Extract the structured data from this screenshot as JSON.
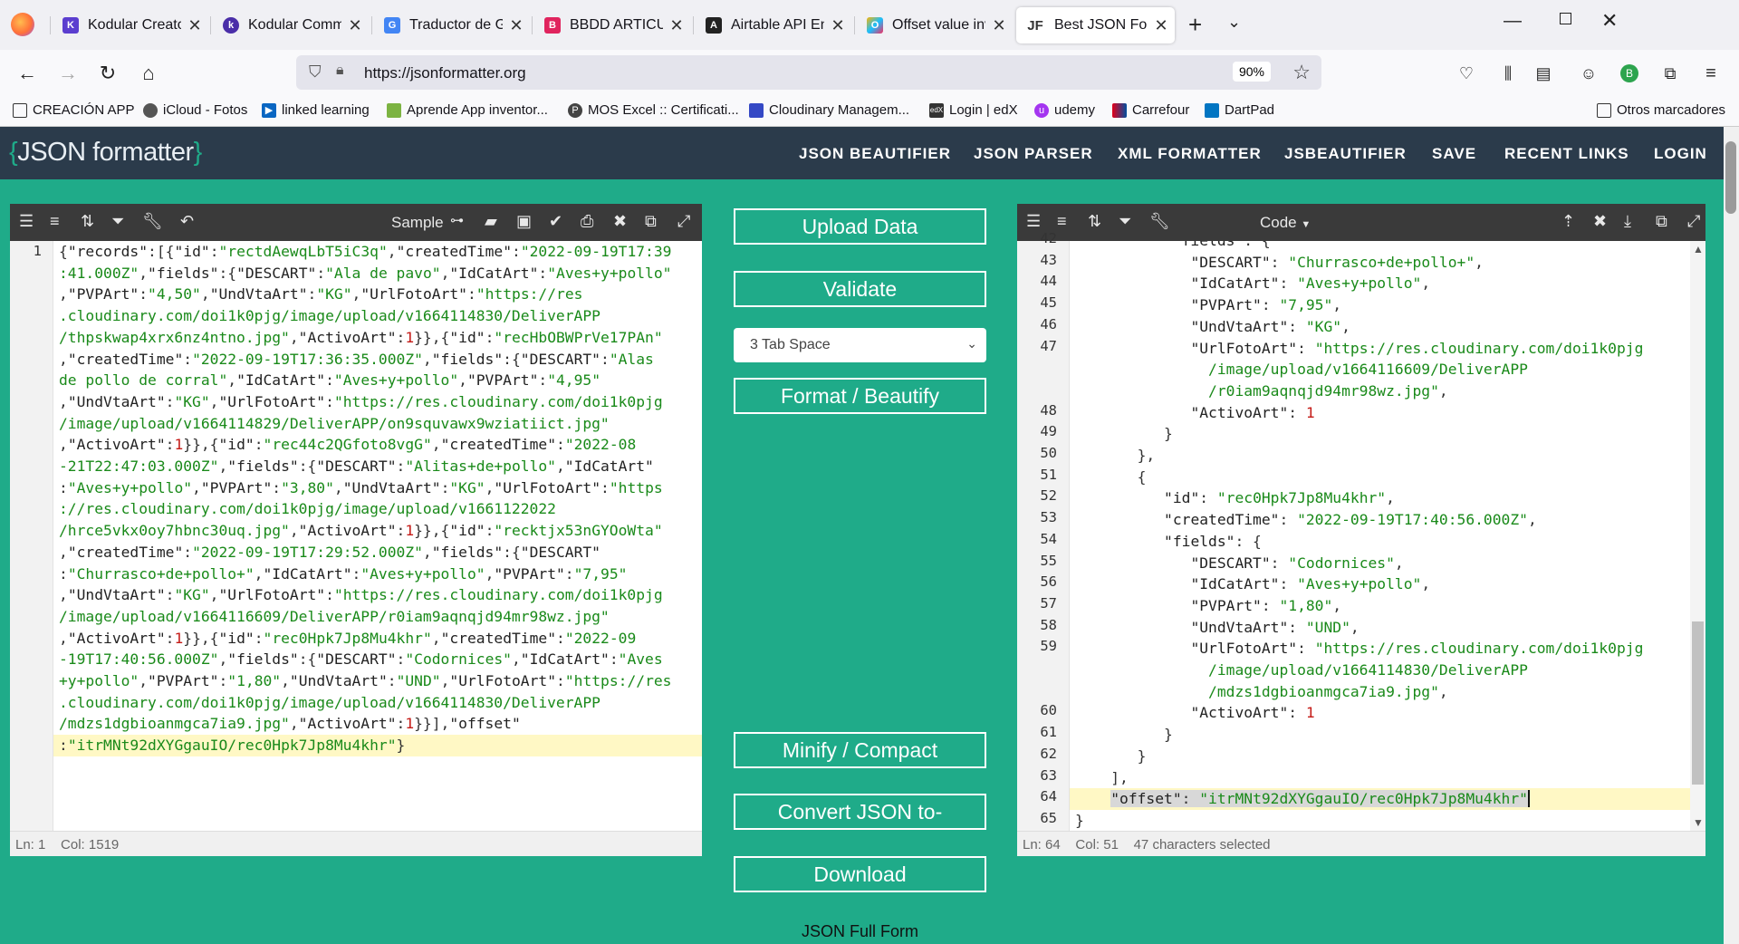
{
  "browser": {
    "tabs": [
      {
        "title": "Kodular Creator",
        "icon": "K"
      },
      {
        "title": "Kodular Community - ",
        "icon": "k"
      },
      {
        "title": "Traductor de Google",
        "icon": "G"
      },
      {
        "title": "BBDD ARTICULOS IMA",
        "icon": "B"
      },
      {
        "title": "Airtable API Encoder",
        "icon": "A"
      },
      {
        "title": "Offset value invalid; ou",
        "icon": "O"
      },
      {
        "title": "Best JSON Formatter a",
        "icon": "JF"
      }
    ],
    "url": "https://jsonformatter.org",
    "zoom": "90%",
    "bookmarks": [
      "CREACIÓN APP",
      "iCloud - Fotos",
      "linked learning",
      "Aprende App inventor...",
      "MOS Excel :: Certificati...",
      "Cloudinary Managem...",
      "Login | edX",
      "udemy",
      "Carrefour",
      "DartPad"
    ],
    "other_bookmarks": "Otros marcadores"
  },
  "site": {
    "logo_open": "{",
    "logo_text": "JSON formatter",
    "logo_close": "}",
    "menu": [
      "JSON BEAUTIFIER",
      "JSON PARSER",
      "XML FORMATTER",
      "JSBEAUTIFIER",
      "SAVE",
      "RECENT LINKS",
      "LOGIN"
    ]
  },
  "left_editor": {
    "sample_label": "Sample",
    "line_number": "1",
    "status": {
      "ln": "Ln: 1",
      "col": "Col: 1519"
    }
  },
  "right_editor": {
    "mode_label": "Code",
    "status": {
      "ln": "Ln: 64",
      "col": "Col: 51",
      "selected": "47 characters selected"
    }
  },
  "buttons": {
    "upload": "Upload Data",
    "validate": "Validate",
    "tab_space": "3 Tab Space",
    "format": "Format / Beautify",
    "minify": "Minify / Compact",
    "convert": "Convert JSON to-",
    "download": "Download"
  },
  "footer_text": "JSON Full Form"
}
